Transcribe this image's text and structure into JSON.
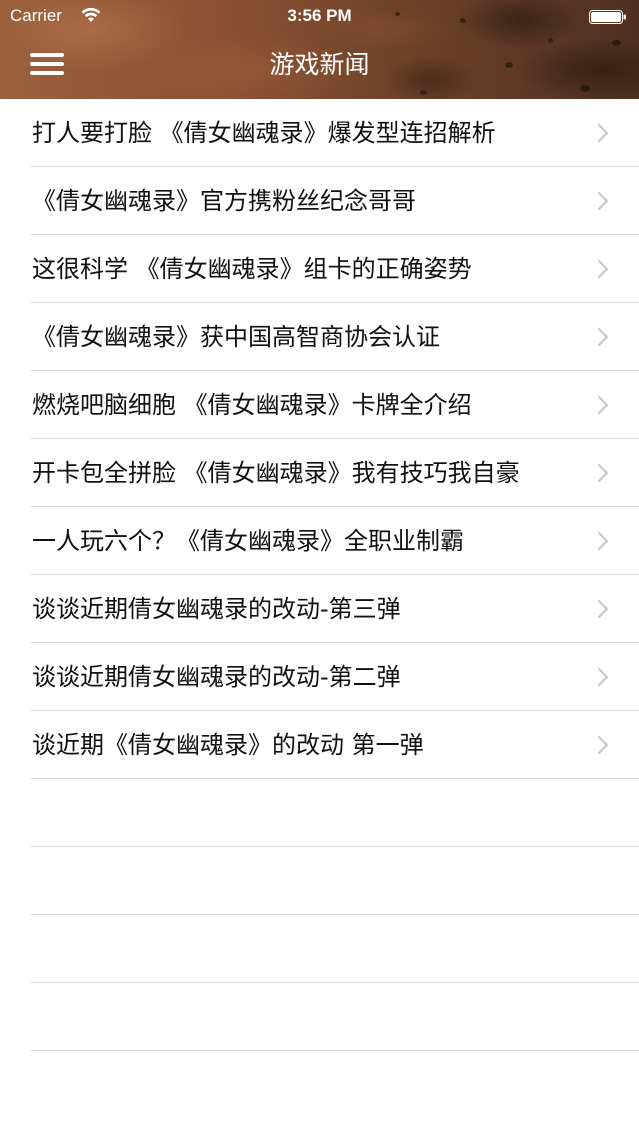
{
  "status_bar": {
    "carrier": "Carrier",
    "time": "3:56 PM"
  },
  "nav": {
    "title": "游戏新闻",
    "menu_icon": "hamburger-menu-icon"
  },
  "news": {
    "items": [
      {
        "title": "打人要打脸 《倩女幽魂录》爆发型连招解析"
      },
      {
        "title": "《倩女幽魂录》官方携粉丝纪念哥哥"
      },
      {
        "title": "这很科学 《倩女幽魂录》组卡的正确姿势"
      },
      {
        "title": "《倩女幽魂录》获中国高智商协会认证"
      },
      {
        "title": "燃烧吧脑细胞 《倩女幽魂录》卡牌全介绍"
      },
      {
        "title": "开卡包全拼脸 《倩女幽魂录》我有技巧我自豪"
      },
      {
        "title": "一人玩六个？《倩女幽魂录》全职业制霸"
      },
      {
        "title": "谈谈近期倩女幽魂录的改动-第三弹"
      },
      {
        "title": "谈谈近期倩女幽魂录的改动-第二弹"
      },
      {
        "title": "谈近期《倩女幽魂录》的改动 第一弹"
      }
    ],
    "row_icon": "chevron-right-icon"
  },
  "colors": {
    "header_brown": "#7a4a2b",
    "separator": "#dcdcdf",
    "chevron": "#c7c7cc",
    "text": "#111111"
  }
}
